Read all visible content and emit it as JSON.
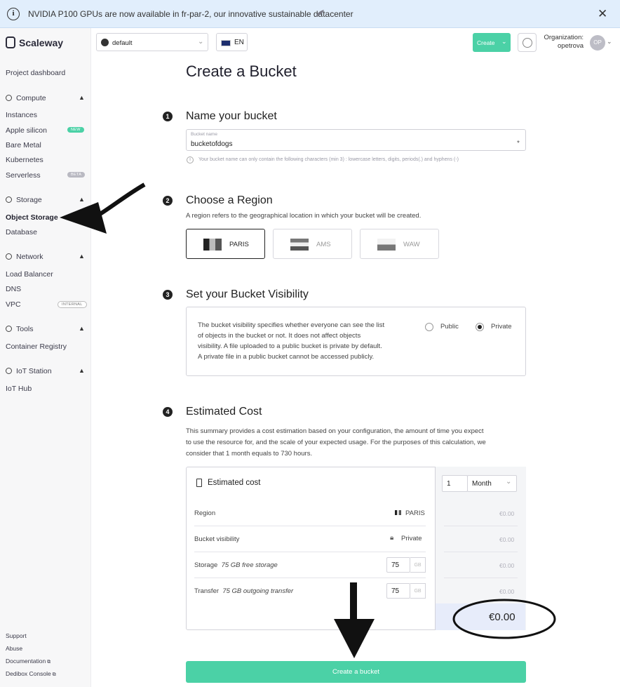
{
  "banner": {
    "text": "NVIDIA P100 GPUs are now available in fr-par-2, our innovative sustainable datacenter",
    "close": "✕"
  },
  "sidebar": {
    "logo": "Scaleway",
    "dashboard": "Project dashboard",
    "compute": {
      "title": "Compute",
      "items": [
        "Instances",
        "Apple silicon",
        "Bare Metal",
        "Kubernetes",
        "Serverless"
      ],
      "badges": {
        "apple": "NEW",
        "serverless": "BETA"
      }
    },
    "storage": {
      "title": "Storage",
      "items": [
        "Object Storage",
        "Database"
      ]
    },
    "network": {
      "title": "Network",
      "items": [
        "Load Balancer",
        "DNS",
        "VPC"
      ],
      "badge": "INTERNAL"
    },
    "tools": {
      "title": "Tools",
      "items": [
        "Container Registry"
      ]
    },
    "iot": {
      "title": "IoT Station",
      "items": [
        "IoT Hub"
      ]
    },
    "footer": [
      "Support",
      "Abuse",
      "Documentation",
      "Dedibox Console"
    ]
  },
  "topbar": {
    "project": "default",
    "lang": "EN",
    "create": "Create",
    "org_label": "Organization:",
    "org_name": "opetrova",
    "avatar": "OP"
  },
  "page": {
    "title": "Create a Bucket"
  },
  "step1": {
    "num": "1",
    "title": "Name your bucket",
    "placeholder": "Bucket name",
    "value": "bucketofdogs",
    "req": "*",
    "hint": "Your bucket name can only contain the following characters (min 3) : lowercase letters, digits, periods(.) and hyphens (-)"
  },
  "step2": {
    "num": "2",
    "title": "Choose a Region",
    "desc": "A region refers to the geographical location in which your bucket will be created.",
    "regions": [
      "PARIS",
      "AMS",
      "WAW"
    ],
    "selected": "PARIS"
  },
  "step3": {
    "num": "3",
    "title": "Set your Bucket Visibility",
    "desc": [
      "The bucket visibility specifies whether everyone can see the list",
      "of objects in the bucket or not. It does not affect objects",
      "visibility. A file uploaded to a public bucket is private by default.",
      "A private file in a public bucket cannot be accessed publicly."
    ],
    "options": [
      "Public",
      "Private"
    ],
    "selected": "Private"
  },
  "step4": {
    "num": "4",
    "title": "Estimated Cost",
    "desc": [
      "This summary provides a cost estimation based on your configuration, the amount of time you expect",
      "to use the resource for, and the scale of your expected usage. For the purposes of this calculation, we",
      "consider that 1 month equals to 730 hours."
    ],
    "box_title": "Estimated cost",
    "duration_value": "1",
    "duration_unit": "Month",
    "rows": [
      {
        "label": "Region",
        "value": "PARIS",
        "price": "€0.00"
      },
      {
        "label": "Bucket visibility",
        "value": "Private",
        "price": "€0.00"
      },
      {
        "label": "Storage",
        "note": "75 GB free storage",
        "qty": "75",
        "unit": "GB",
        "price": "€0.00"
      },
      {
        "label": "Transfer",
        "note": "75 GB outgoing transfer",
        "qty": "75",
        "unit": "GB",
        "price": "€0.00"
      }
    ],
    "total": "€0.00"
  },
  "submit": "Create a bucket",
  "colors": {
    "accent": "#4bd1a6",
    "banner": "#e1eefc"
  }
}
